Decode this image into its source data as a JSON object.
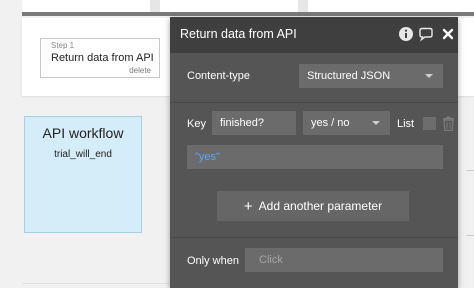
{
  "workflow": {
    "step": {
      "label": "Step 1",
      "title": "Return data from API",
      "delete_label": "delete"
    },
    "event": {
      "title": "API workflow",
      "subtitle": "trial_will_end"
    }
  },
  "editor": {
    "title": "Return data from API",
    "content_type": {
      "label": "Content-type",
      "value": "Structured JSON"
    },
    "parameter": {
      "key_label": "Key",
      "key_value": "finished?",
      "type_value": "yes / no",
      "list_label": "List",
      "value": "\"yes\""
    },
    "add_parameter_label": "Add another parameter",
    "only_when": {
      "label": "Only when",
      "placeholder": "Click"
    }
  },
  "icons": [
    "info-icon",
    "comment-icon",
    "close-icon",
    "trash-icon",
    "plus-icon",
    "chevron-down-icon"
  ],
  "colors": {
    "editor_bg": "#555555",
    "editor_header": "#3f3f3f",
    "field_bg": "#6b6b6b",
    "value_text": "#5aa8ff",
    "event_card": "#d5ecf9"
  }
}
